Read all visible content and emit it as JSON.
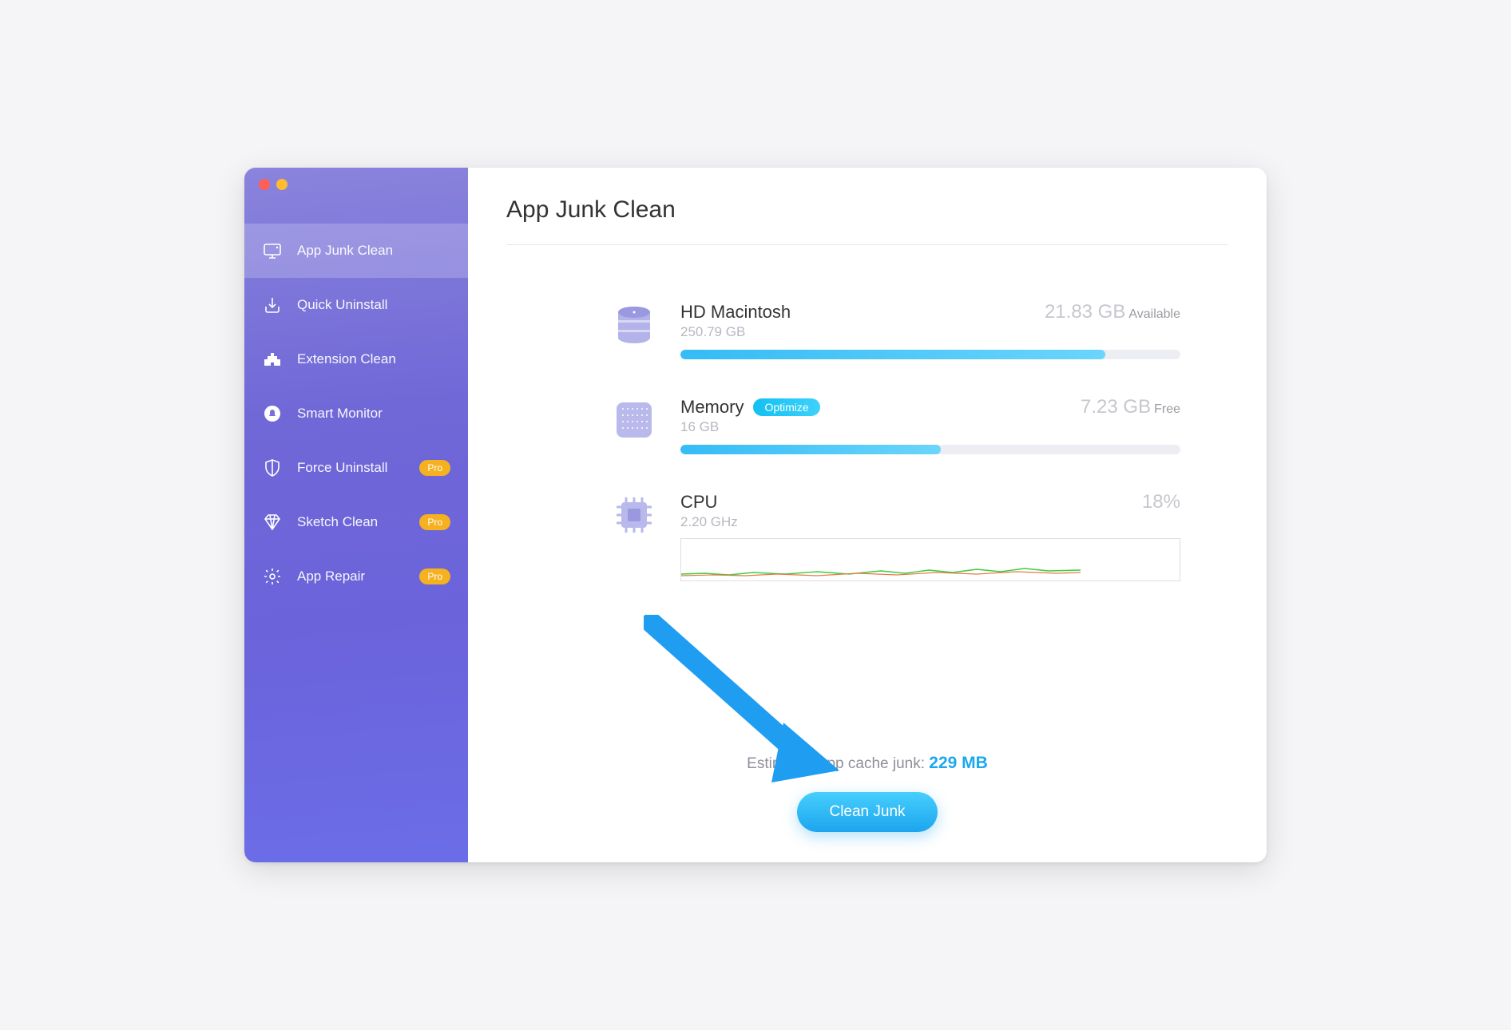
{
  "page_title": "App Junk Clean",
  "sidebar": {
    "items": [
      {
        "label": "App Junk Clean",
        "icon": "monitor-icon",
        "pro": false,
        "active": true
      },
      {
        "label": "Quick Uninstall",
        "icon": "download-icon",
        "pro": false,
        "active": false
      },
      {
        "label": "Extension Clean",
        "icon": "puzzle-icon",
        "pro": false,
        "active": false
      },
      {
        "label": "Smart Monitor",
        "icon": "bell-icon",
        "pro": false,
        "active": false
      },
      {
        "label": "Force Uninstall",
        "icon": "shield-icon",
        "pro": true,
        "active": false
      },
      {
        "label": "Sketch Clean",
        "icon": "diamond-icon",
        "pro": true,
        "active": false
      },
      {
        "label": "App Repair",
        "icon": "gear-icon",
        "pro": true,
        "active": false
      }
    ],
    "pro_label": "Pro"
  },
  "disk": {
    "title": "HD Macintosh",
    "total": "250.79 GB",
    "right_value": "21.83 GB",
    "right_unit": "Available",
    "fill_pct": 85
  },
  "memory": {
    "title": "Memory",
    "optimize_label": "Optimize",
    "total": "16 GB",
    "right_value": "7.23 GB",
    "right_unit": "Free",
    "fill_pct": 52
  },
  "cpu": {
    "title": "CPU",
    "freq": "2.20 GHz",
    "usage": "18%"
  },
  "estimate_prefix": "Estimated app cache junk: ",
  "estimate_value": "229 MB",
  "clean_button": "Clean Junk"
}
